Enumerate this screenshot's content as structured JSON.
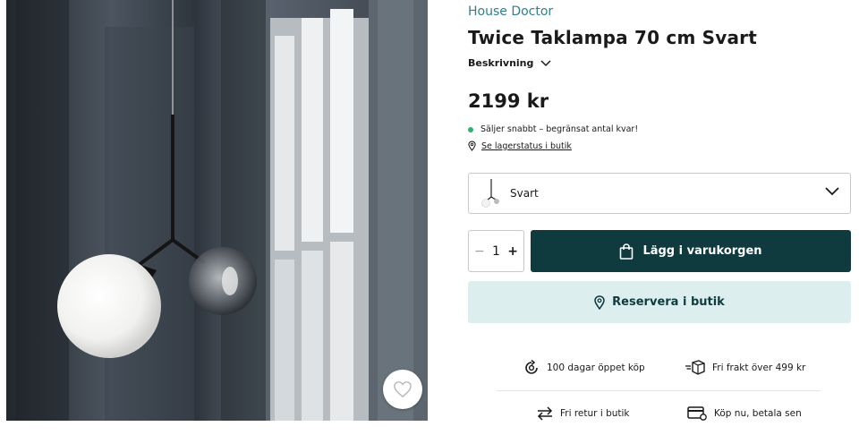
{
  "product": {
    "brand": "House Doctor",
    "title": "Twice Taklampa 70 cm Svart",
    "description_label": "Beskrivning",
    "price": "2199 kr",
    "stock_status": "Säljer snabbt – begränsat antal kvar!",
    "store_status_link": "Se lagerstatus i butik",
    "status_color": "#2fb36a"
  },
  "variant": {
    "selected": "Svart"
  },
  "quantity": {
    "value": "1",
    "minus": "−",
    "plus": "+"
  },
  "actions": {
    "add_to_cart": "Lägg i varukorgen",
    "reserve": "Reservera i butik",
    "primary_color": "#0f3b3f",
    "secondary_color": "#dcefee"
  },
  "perks": [
    {
      "icon": "return-days-icon",
      "label": "100 dagar öppet köp"
    },
    {
      "icon": "free-shipping-icon",
      "label": "Fri frakt över 499 kr"
    },
    {
      "icon": "exchange-arrows-icon",
      "label": "Fri retur i butik"
    },
    {
      "icon": "card-icon",
      "label": "Köp nu, betala sen"
    }
  ],
  "image": {
    "alt_icon": "heart-icon"
  }
}
